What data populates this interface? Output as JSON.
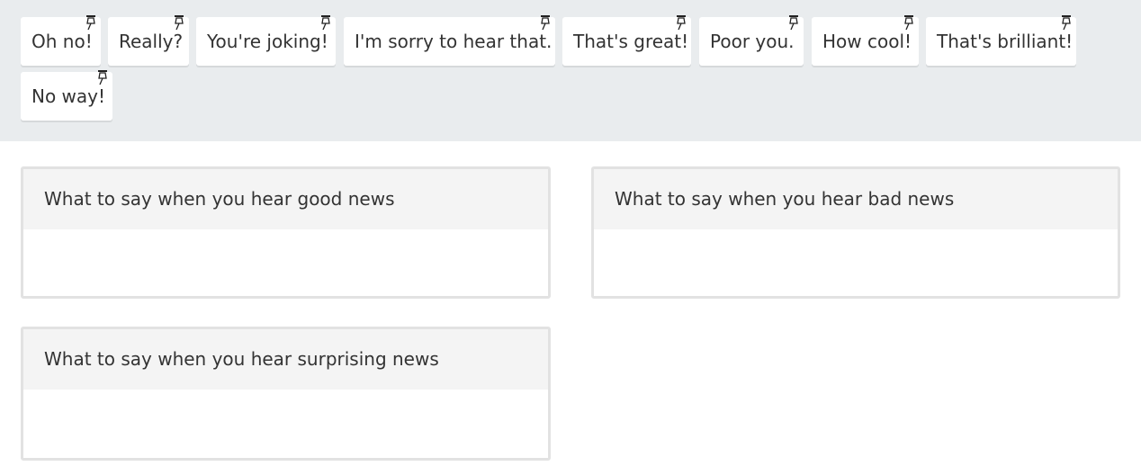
{
  "word_bank": {
    "chips": [
      "Oh no!",
      "Really?",
      "You're joking!",
      "I'm sorry to hear that.",
      "That's great!",
      "Poor you.",
      "How cool!",
      "That's brilliant!",
      "No way!"
    ],
    "pin_icon": "pushpin-icon"
  },
  "categories": [
    {
      "title": "What to say when you hear good news"
    },
    {
      "title": "What to say when you hear bad news"
    },
    {
      "title": "What to say when you hear surprising news"
    }
  ]
}
